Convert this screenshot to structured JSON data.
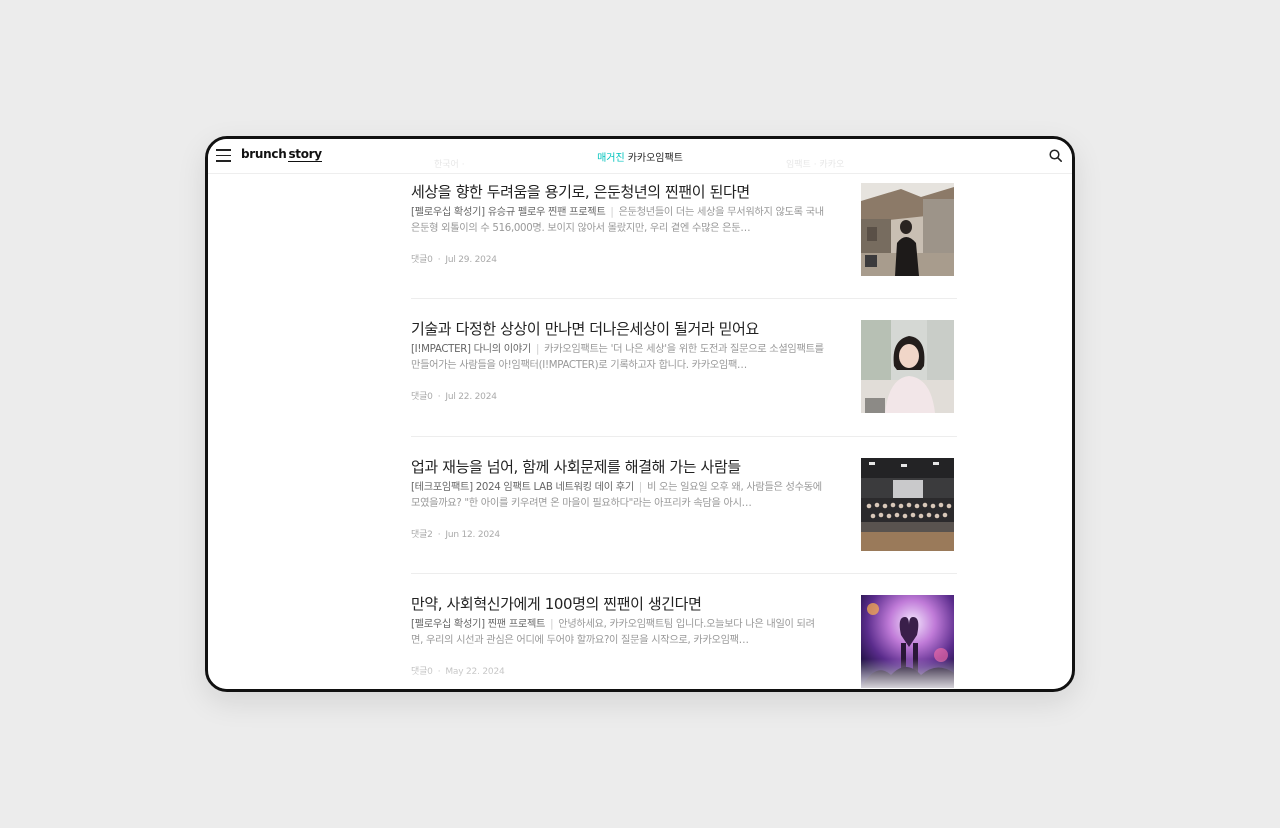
{
  "header": {
    "logo_brunch": "brunch",
    "logo_story": "story",
    "magazine_label": "매거진",
    "magazine_name": "카카오임팩트",
    "ghost_left": "한국어 ·",
    "ghost_right": "임팩트 · 카카오"
  },
  "articles": [
    {
      "title": "세상을 향한 두려움을 용기로, 은둔청년의 찐팬이 된다면",
      "tag": "[펠로우십 확성기] 유승규 펠로우 찐팬 프로젝트",
      "excerpt": "은둔청년들이 더는 세상을 무서워하지 않도록 국내 은둔형 외톨이의 수 516,000명. 보이지 않아서 몰랐지만, 우리 곁엔 수많은 은둔…",
      "comments": "댓글0",
      "date": "Jul 29. 2024"
    },
    {
      "title": "기술과 다정한 상상이 만나면 더나은세상이 될거라 믿어요",
      "tag": "[I!MPACTER] 다니의 이야기",
      "excerpt": "카카오임팩트는 '더 나은 세상'을 위한 도전과 질문으로 소셜임팩트를 만들어가는 사람들을 아!임팩터(I!MPACTER)로 기록하고자 합니다. 카카오임팩…",
      "comments": "댓글0",
      "date": "Jul 22. 2024"
    },
    {
      "title": "업과 재능을 넘어, 함께 사회문제를 해결해 가는 사람들",
      "tag": "[테크포임팩트] 2024 임팩트 LAB 네트워킹 데이 후기",
      "excerpt": "비 오는 일요일 오후 왜, 사람들은 성수동에 모였을까요? \"한 아이를 키우려면 온 마을이 필요하다\"라는 아프리카 속담을 아시…",
      "comments": "댓글2",
      "date": "Jun 12. 2024"
    },
    {
      "title": "만약, 사회혁신가에게 100명의 찐팬이 생긴다면",
      "tag": "[펠로우십 확성기] 찐팬 프로젝트",
      "excerpt": "안녕하세요, 카카오임팩트팀 입니다.오늘보다 나은 내일이 되려면, 우리의 시선과 관심은 어디에 두어야 할까요?이 질문을 시작으로, 카카오임팩…",
      "comments": "댓글0",
      "date": "May 22. 2024"
    }
  ]
}
